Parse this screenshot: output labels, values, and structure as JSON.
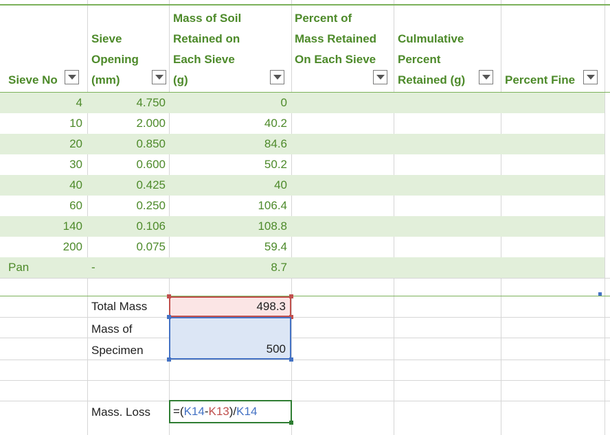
{
  "headers": {
    "sieve_no": "Sieve No",
    "sieve_opening": "Sieve\nOpening\n(mm)",
    "mass_retained": "Mass of Soil\nRetained on\nEach Sieve\n(g)",
    "percent_retained": "Percent of\nMass Retained\nOn Each Sieve",
    "cumulative": "Culmulative\nPercent\nRetained (g)",
    "percent_fine": "Percent Fine"
  },
  "rows": [
    {
      "sieve": "4",
      "opening": "4.750",
      "mass": "0"
    },
    {
      "sieve": "10",
      "opening": "2.000",
      "mass": "40.2"
    },
    {
      "sieve": "20",
      "opening": "0.850",
      "mass": "84.6"
    },
    {
      "sieve": "30",
      "opening": "0.600",
      "mass": "50.2"
    },
    {
      "sieve": "40",
      "opening": "0.425",
      "mass": "40"
    },
    {
      "sieve": "60",
      "opening": "0.250",
      "mass": "106.4"
    },
    {
      "sieve": "140",
      "opening": "0.106",
      "mass": "108.8"
    },
    {
      "sieve": "200",
      "opening": "0.075",
      "mass": "59.4"
    },
    {
      "sieve": "Pan",
      "opening": "-",
      "mass": "8.7"
    }
  ],
  "summary": {
    "total_mass_label": "Total Mass",
    "total_mass_value": "498.3",
    "specimen_label": "Mass of\nSpecimen",
    "specimen_value": "500",
    "mass_loss_label": "Mass. Loss",
    "formula": {
      "open": "=(",
      "ref1": "K14",
      "minus": "-",
      "ref2": "K13",
      "close": ")/",
      "ref3": "K14"
    }
  },
  "colors": {
    "header_green": "#4d8a2a",
    "band": "#e2efda",
    "ref_blue": "#4472c4",
    "ref_red": "#c0504d",
    "active_cell": "#2e7d32"
  }
}
